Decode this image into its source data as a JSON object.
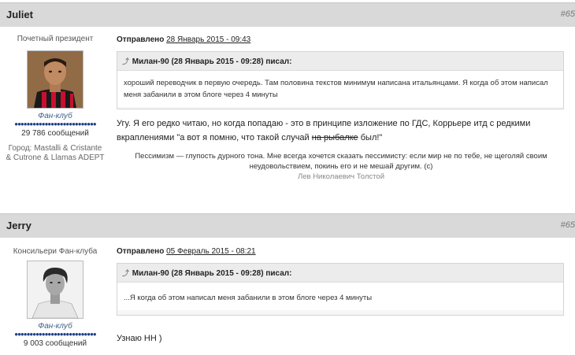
{
  "posts": [
    {
      "username": "Juliet",
      "post_number": "#65",
      "user_title": "Почетный президент",
      "club": "Фан-клуб",
      "rating_dots": "●●●●●●●●●●●●●●●●●●●●●●●●●●●",
      "message_count": "29 786 сообщений",
      "city_line1": "Город: Mastalli & Cristante",
      "city_line2": "& Cutrone & Llamas ADEPT",
      "sent_label": "Отправлено",
      "sent_date": "28 Январь 2015 - 09:43",
      "quote_header": "Милан-90 (28 Январь 2015 - 09:28) писал:",
      "quote_text": "хороший переводчик в первую очередь. Там половина текстов минимум написана итальянцами. Я когда об этом написал меня забанили в этом блоге через 4 минуты",
      "message_before": "Угу. Я его редко читаю, но когда попадаю - это в принципе изложение по ГДС, Коррьере итд с редкими вкраплениями \"а вот я помню, что такой случай ",
      "message_strike": "на рыбалке",
      "message_after": " был!\"",
      "signature_text": "Пессимизм — глупость дурного тона. Мне всегда хочется сказать пессимисту: если мир не по тебе, не щеголяй своим неудовольствием, покинь его и не мешай другим. (c)",
      "signature_author": "Лев Николаевич Толстой"
    },
    {
      "username": "Jerry",
      "post_number": "#65",
      "user_title": "Консильери Фан-клуба",
      "club": "Фан-клуб",
      "rating_dots": "●●●●●●●●●●●●●●●●●●●●●●●●●●●",
      "message_count": "9 003 сообщений",
      "sent_label": "Отправлено",
      "sent_date": "05 Февраль 2015 - 08:21",
      "quote_header": "Милан-90 (28 Январь 2015 - 09:28) писал:",
      "quote_text": "...Я когда об этом написал меня забанили в этом блоге через 4 минуты",
      "message": "Узнаю НН )"
    }
  ],
  "colors": {
    "header_bg": "#d9d9d9",
    "milan_red": "#c8102e",
    "link_blue": "#3a5f8a"
  },
  "icons": {
    "quote": "quote-arrow-icon"
  }
}
